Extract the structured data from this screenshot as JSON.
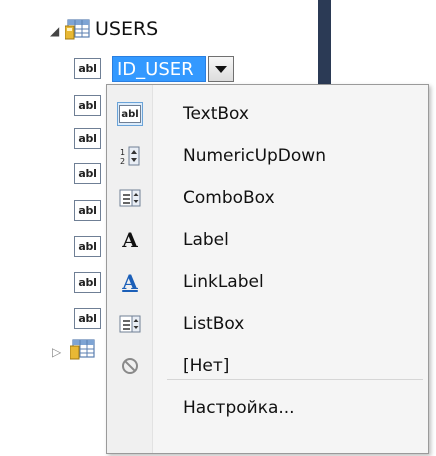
{
  "tree": {
    "table_name": "USERS",
    "selected_field": "ID_USER"
  },
  "menu": {
    "items": [
      {
        "label": "TextBox",
        "icon": "textbox-icon",
        "highlighted": true
      },
      {
        "label": "NumericUpDown",
        "icon": "numeric-updown-icon"
      },
      {
        "label": "ComboBox",
        "icon": "combobox-icon"
      },
      {
        "label": "Label",
        "icon": "label-icon"
      },
      {
        "label": "LinkLabel",
        "icon": "linklabel-icon"
      },
      {
        "label": "ListBox",
        "icon": "listbox-icon"
      },
      {
        "label": "[Нет]",
        "icon": "none-icon"
      },
      {
        "label": "Настройка...",
        "icon": ""
      }
    ],
    "abl_text": "abl"
  },
  "colors": {
    "selection": "#3399ff",
    "panel_bar": "#2b3a55",
    "link": "#1b5fb8"
  }
}
